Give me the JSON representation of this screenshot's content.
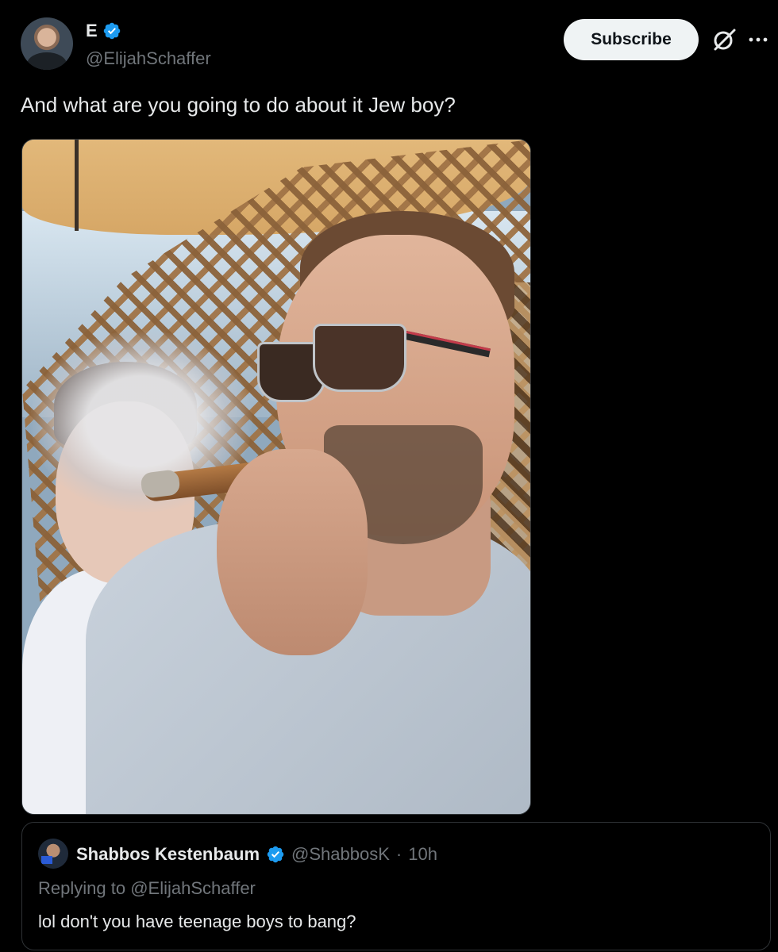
{
  "author": {
    "display_name": "E",
    "handle": "@ElijahSchaffer",
    "verified": true
  },
  "header": {
    "subscribe_label": "Subscribe",
    "grok_icon": "grok-icon",
    "more_icon": "more-icon"
  },
  "tweet": {
    "text": "And what are you going to do about it Jew boy?"
  },
  "quoted_tweet": {
    "display_name": "Shabbos Kestenbaum",
    "handle": "@ShabbosK",
    "separator": "·",
    "time": "10h",
    "replying_prefix": "Replying to",
    "replying_to": "@ElijahSchaffer",
    "text": "lol don't you have teenage boys to bang?",
    "verified": true
  },
  "colors": {
    "background": "#000000",
    "text_primary": "#e7e9ea",
    "text_secondary": "#71767b",
    "verified_blue": "#1d9bf0",
    "border": "#2f3336",
    "button_bg": "#eff3f4"
  }
}
